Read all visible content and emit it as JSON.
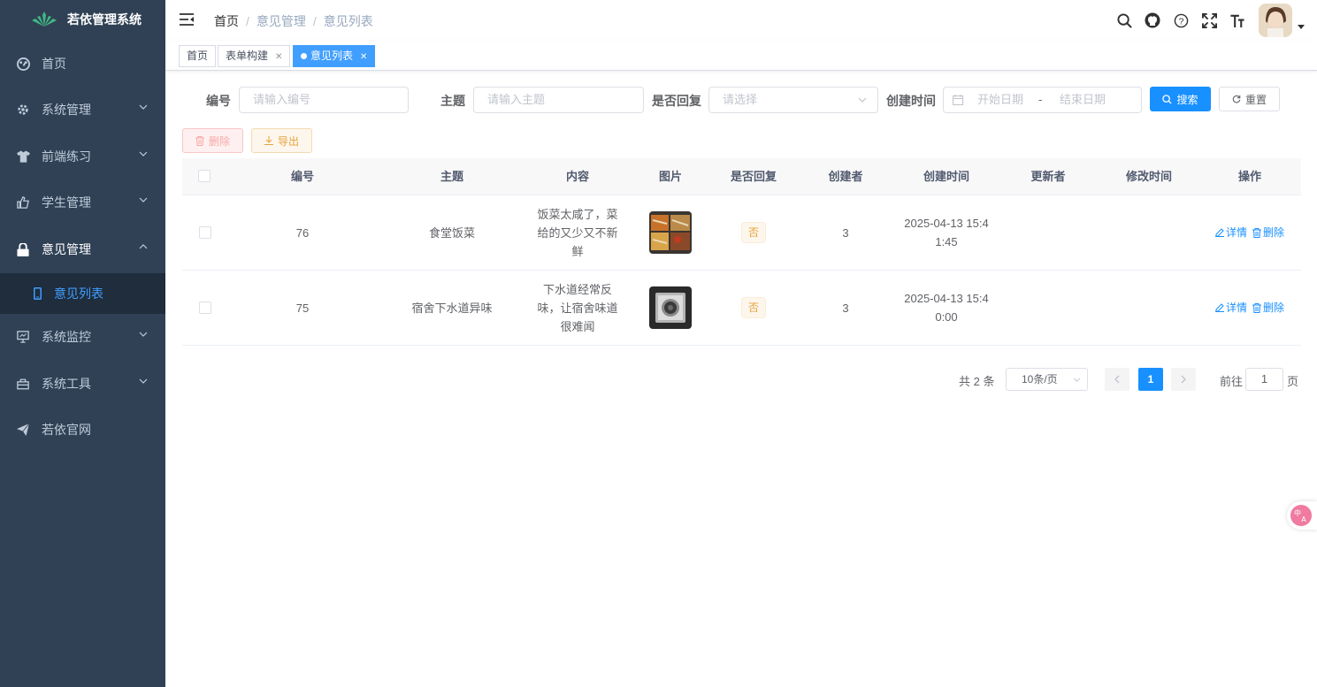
{
  "sidebar": {
    "title": "若依管理系统",
    "items": [
      {
        "label": "首页",
        "icon": "dashboard-icon"
      },
      {
        "label": "系统管理",
        "icon": "gear-icon"
      },
      {
        "label": "前端练习",
        "icon": "shirt-icon"
      },
      {
        "label": "学生管理",
        "icon": "thumb-icon"
      },
      {
        "label": "意见管理",
        "icon": "lock-icon",
        "expanded": true
      },
      {
        "label": "系统监控",
        "icon": "monitor-icon"
      },
      {
        "label": "系统工具",
        "icon": "toolbox-icon"
      },
      {
        "label": "若依官网",
        "icon": "send-icon"
      }
    ],
    "submenu": {
      "label": "意见列表",
      "icon": "phone-icon"
    }
  },
  "breadcrumb": [
    "首页",
    "意见管理",
    "意见列表"
  ],
  "tags": [
    {
      "label": "首页"
    },
    {
      "label": "表单构建"
    },
    {
      "label": "意见列表",
      "active": true
    }
  ],
  "search": {
    "id_label": "编号",
    "id_placeholder": "请输入编号",
    "topic_label": "主题",
    "topic_placeholder": "请输入主题",
    "reply_label": "是否回复",
    "reply_placeholder": "请选择",
    "time_label": "创建时间",
    "start_placeholder": "开始日期",
    "range_sep": "-",
    "end_placeholder": "结束日期",
    "search_btn": "搜索",
    "reset_btn": "重置"
  },
  "toolbar": {
    "delete": "删除",
    "export": "导出"
  },
  "table": {
    "headers": [
      "编号",
      "主题",
      "内容",
      "图片",
      "是否回复",
      "创建者",
      "创建时间",
      "更新者",
      "修改时间",
      "操作"
    ],
    "rows": [
      {
        "id": "76",
        "topic": "食堂饭菜",
        "content": "饭菜太咸了，菜给的又少又不新鲜",
        "reply": "否",
        "creator": "3",
        "created": "2025-04-13 15:41:45",
        "updater": "",
        "modified": "",
        "detail": "详情",
        "delete": "删除"
      },
      {
        "id": "75",
        "topic": "宿舍下水道异味",
        "content": "下水道经常反味，让宿舍味道很难闻",
        "reply": "否",
        "creator": "3",
        "created": "2025-04-13 15:40:00",
        "updater": "",
        "modified": "",
        "detail": "详情",
        "delete": "删除"
      }
    ]
  },
  "pagination": {
    "total": "共 2 条",
    "page_size": "10条/页",
    "current": "1",
    "goto": "前往",
    "goto_value": "1",
    "page_unit": "页"
  },
  "colors": {
    "sidebar_bg": "#304156",
    "primary": "#1890ff",
    "warning": "#e6a23c"
  }
}
